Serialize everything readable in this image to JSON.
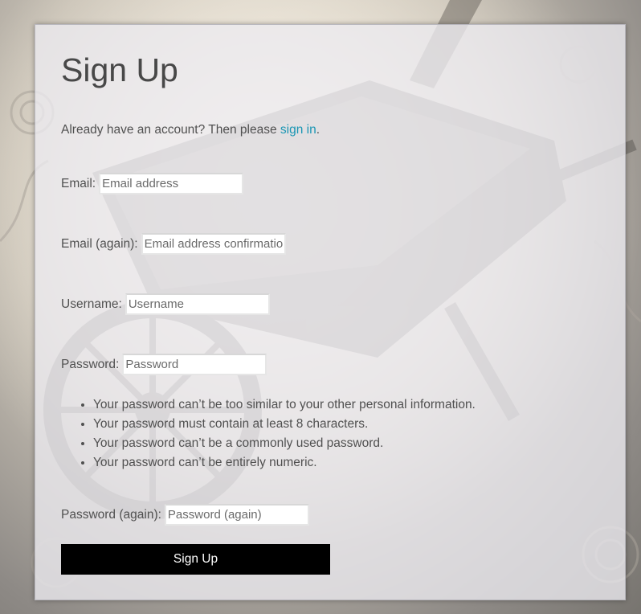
{
  "page": {
    "title": "Sign Up",
    "intro_text": "Already have an account? Then please ",
    "signin_link": "sign in",
    "intro_end": "."
  },
  "form": {
    "email": {
      "label": "Email:",
      "placeholder": "Email address"
    },
    "email_again": {
      "label": "Email (again):",
      "placeholder": "Email address confirmation"
    },
    "username": {
      "label": "Username:",
      "placeholder": "Username"
    },
    "password": {
      "label": "Password:",
      "placeholder": "Password"
    },
    "password_help": [
      "Your password can’t be too similar to your other personal information.",
      "Your password must contain at least 8 characters.",
      "Your password can’t be a commonly used password.",
      "Your password can’t be entirely numeric."
    ],
    "password_again": {
      "label": "Password (again):",
      "placeholder": "Password (again)"
    },
    "submit_label": "Sign Up"
  },
  "colors": {
    "link": "#1b96b4",
    "button_bg": "#000000",
    "button_text": "#ffffff"
  }
}
